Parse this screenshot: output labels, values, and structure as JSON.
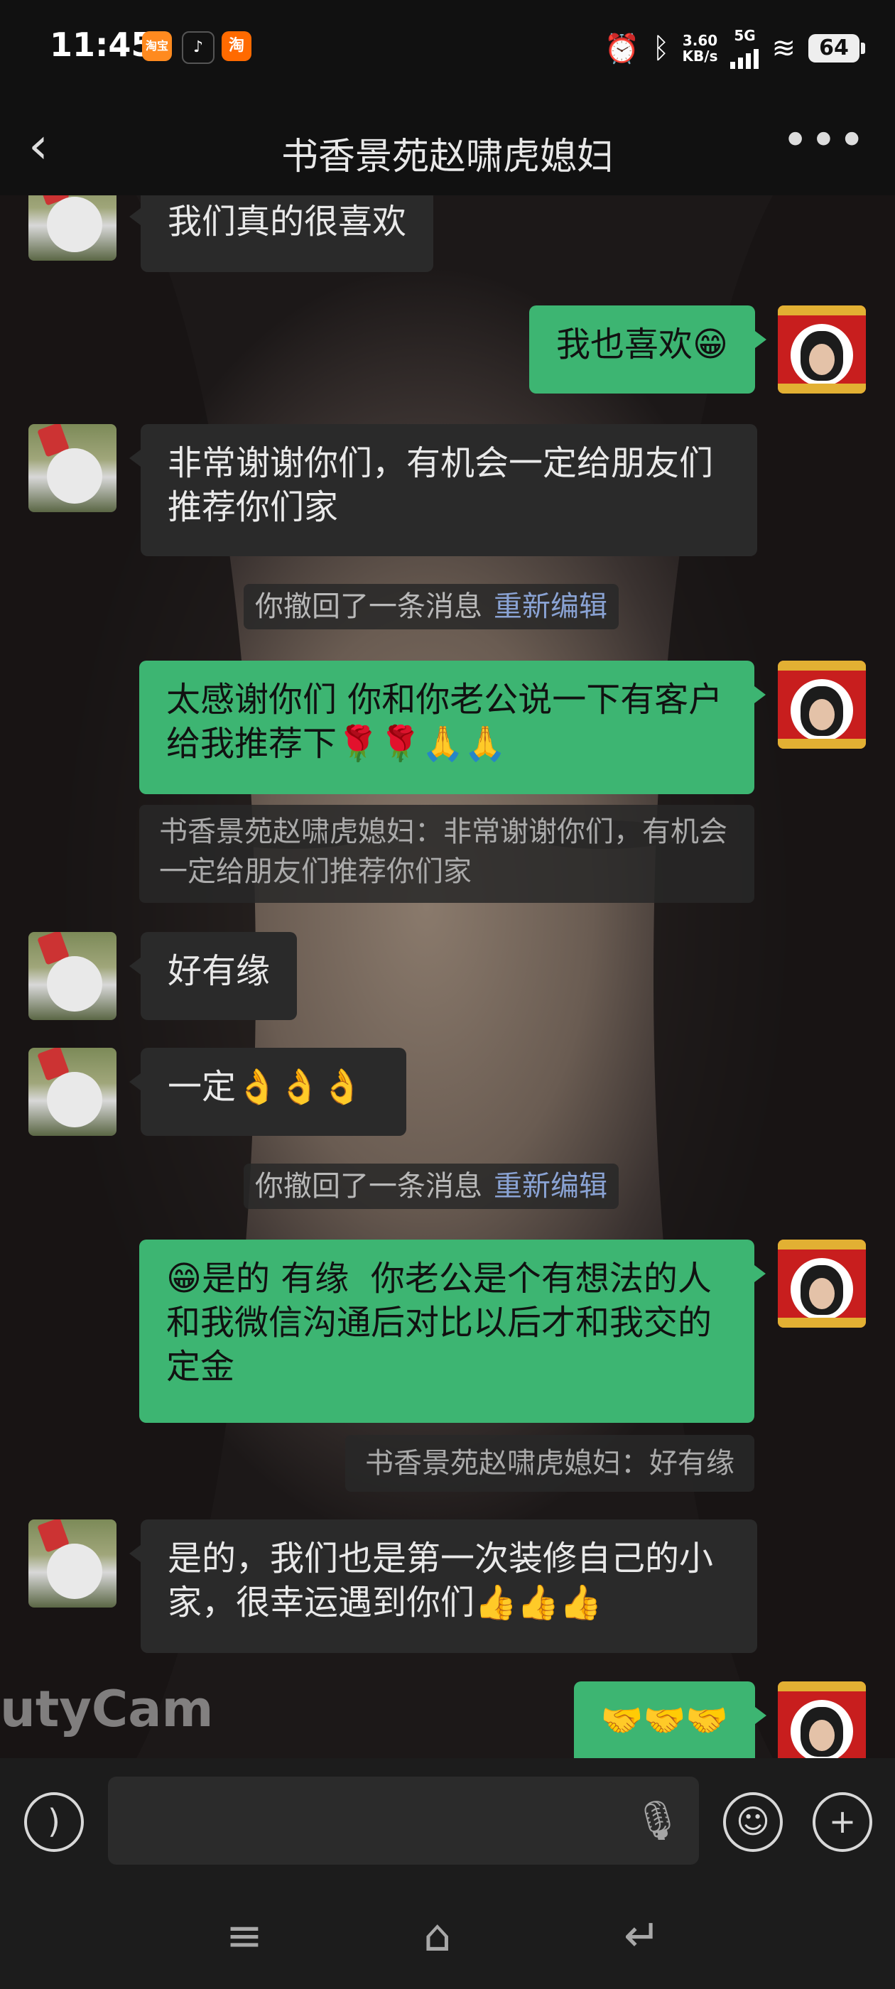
{
  "status_bar": {
    "time": "11:45",
    "apps": [
      {
        "name": "taobao-live-icon",
        "text": "淘宝",
        "color": "#ff8a1f"
      },
      {
        "name": "tiktok-icon",
        "text": "♪",
        "color": "#111111"
      },
      {
        "name": "taobao-icon",
        "text": "淘",
        "color": "#ff6a00"
      }
    ],
    "net_speed": "3.60",
    "net_unit": "KB/s",
    "network": "5G",
    "battery": "64"
  },
  "header": {
    "back_icon": "‹",
    "title": "书香景苑赵啸虎媳妇",
    "more_icon": "•••"
  },
  "messages": {
    "m1": "我们真的很喜欢",
    "m2": "我也喜欢😁",
    "m3": "非常谢谢你们，有机会一定给朋友们推荐你们家",
    "sys1": "你撤回了一条消息",
    "sys1_link": "重新编辑",
    "m4": "太感谢你们 你和你老公说一下有客户给我推荐下🌹🌹🙏🙏",
    "q1": "书香景苑赵啸虎媳妇：非常谢谢你们，有机会一定给朋友们推荐你们家",
    "m5": "好有缘",
    "m6": "一定👌👌👌",
    "sys2": "你撤回了一条消息",
    "sys2_link": "重新编辑",
    "m7": "😁是的 有缘  你老公是个有想法的人 和我微信沟通后对比以后才和我交的定金",
    "q2": "书香景苑赵啸虎媳妇：好有缘",
    "m8": "是的，我们也是第一次装修自己的小家，很幸运遇到你们👍👍👍",
    "m9": "🤝🤝🤝"
  },
  "watermark": "utyCam",
  "input_bar": {
    "voice_icon": "voice-toggle-icon",
    "mic_icon": "microphone-icon",
    "emoji_icon": "emoji-icon",
    "plus_icon": "plus-icon"
  },
  "colors": {
    "my_bubble": "#3db572",
    "other_bubble": "#2a2a2a",
    "link": "#8aa3d4"
  }
}
